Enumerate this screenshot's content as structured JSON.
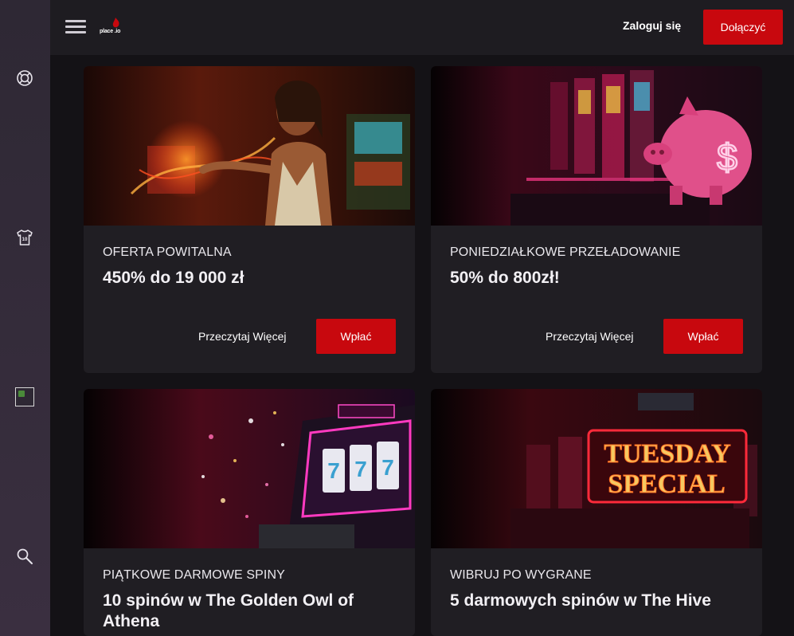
{
  "sidebar": {
    "items": [
      {
        "icon": "lifebuoy-icon"
      },
      {
        "icon": "jersey-icon"
      },
      {
        "icon": "broken-image-icon"
      },
      {
        "icon": "search-icon"
      }
    ]
  },
  "header": {
    "logo_text": "place    .io",
    "login_label": "Zaloguj się",
    "join_label": "Dołączyć"
  },
  "promotions": [
    {
      "label": "OFERTA POWITALNA",
      "title": "450% do 19 000 zł",
      "read_more": "Przeczytaj Więcej",
      "cta": "Wpłać"
    },
    {
      "label": "PONIEDZIAŁKOWE PRZEŁADOWANIE",
      "title": "50% do 800zł!",
      "read_more": "Przeczytaj Więcej",
      "cta": "Wpłać"
    },
    {
      "label": "PIĄTKOWE DARMOWE SPINY",
      "title": "10 spinów w The Golden Owl of Athena"
    },
    {
      "label": "WIBRUJ PO WYGRANE",
      "title": "5 darmowych spinów w The Hive",
      "image_text": [
        "TUESDAY",
        "SPECIAL"
      ]
    }
  ],
  "colors": {
    "accent": "#c8080e",
    "background": "#141216",
    "card": "#201e23",
    "sidebar": "#2e2834",
    "header": "#1e1c21"
  }
}
